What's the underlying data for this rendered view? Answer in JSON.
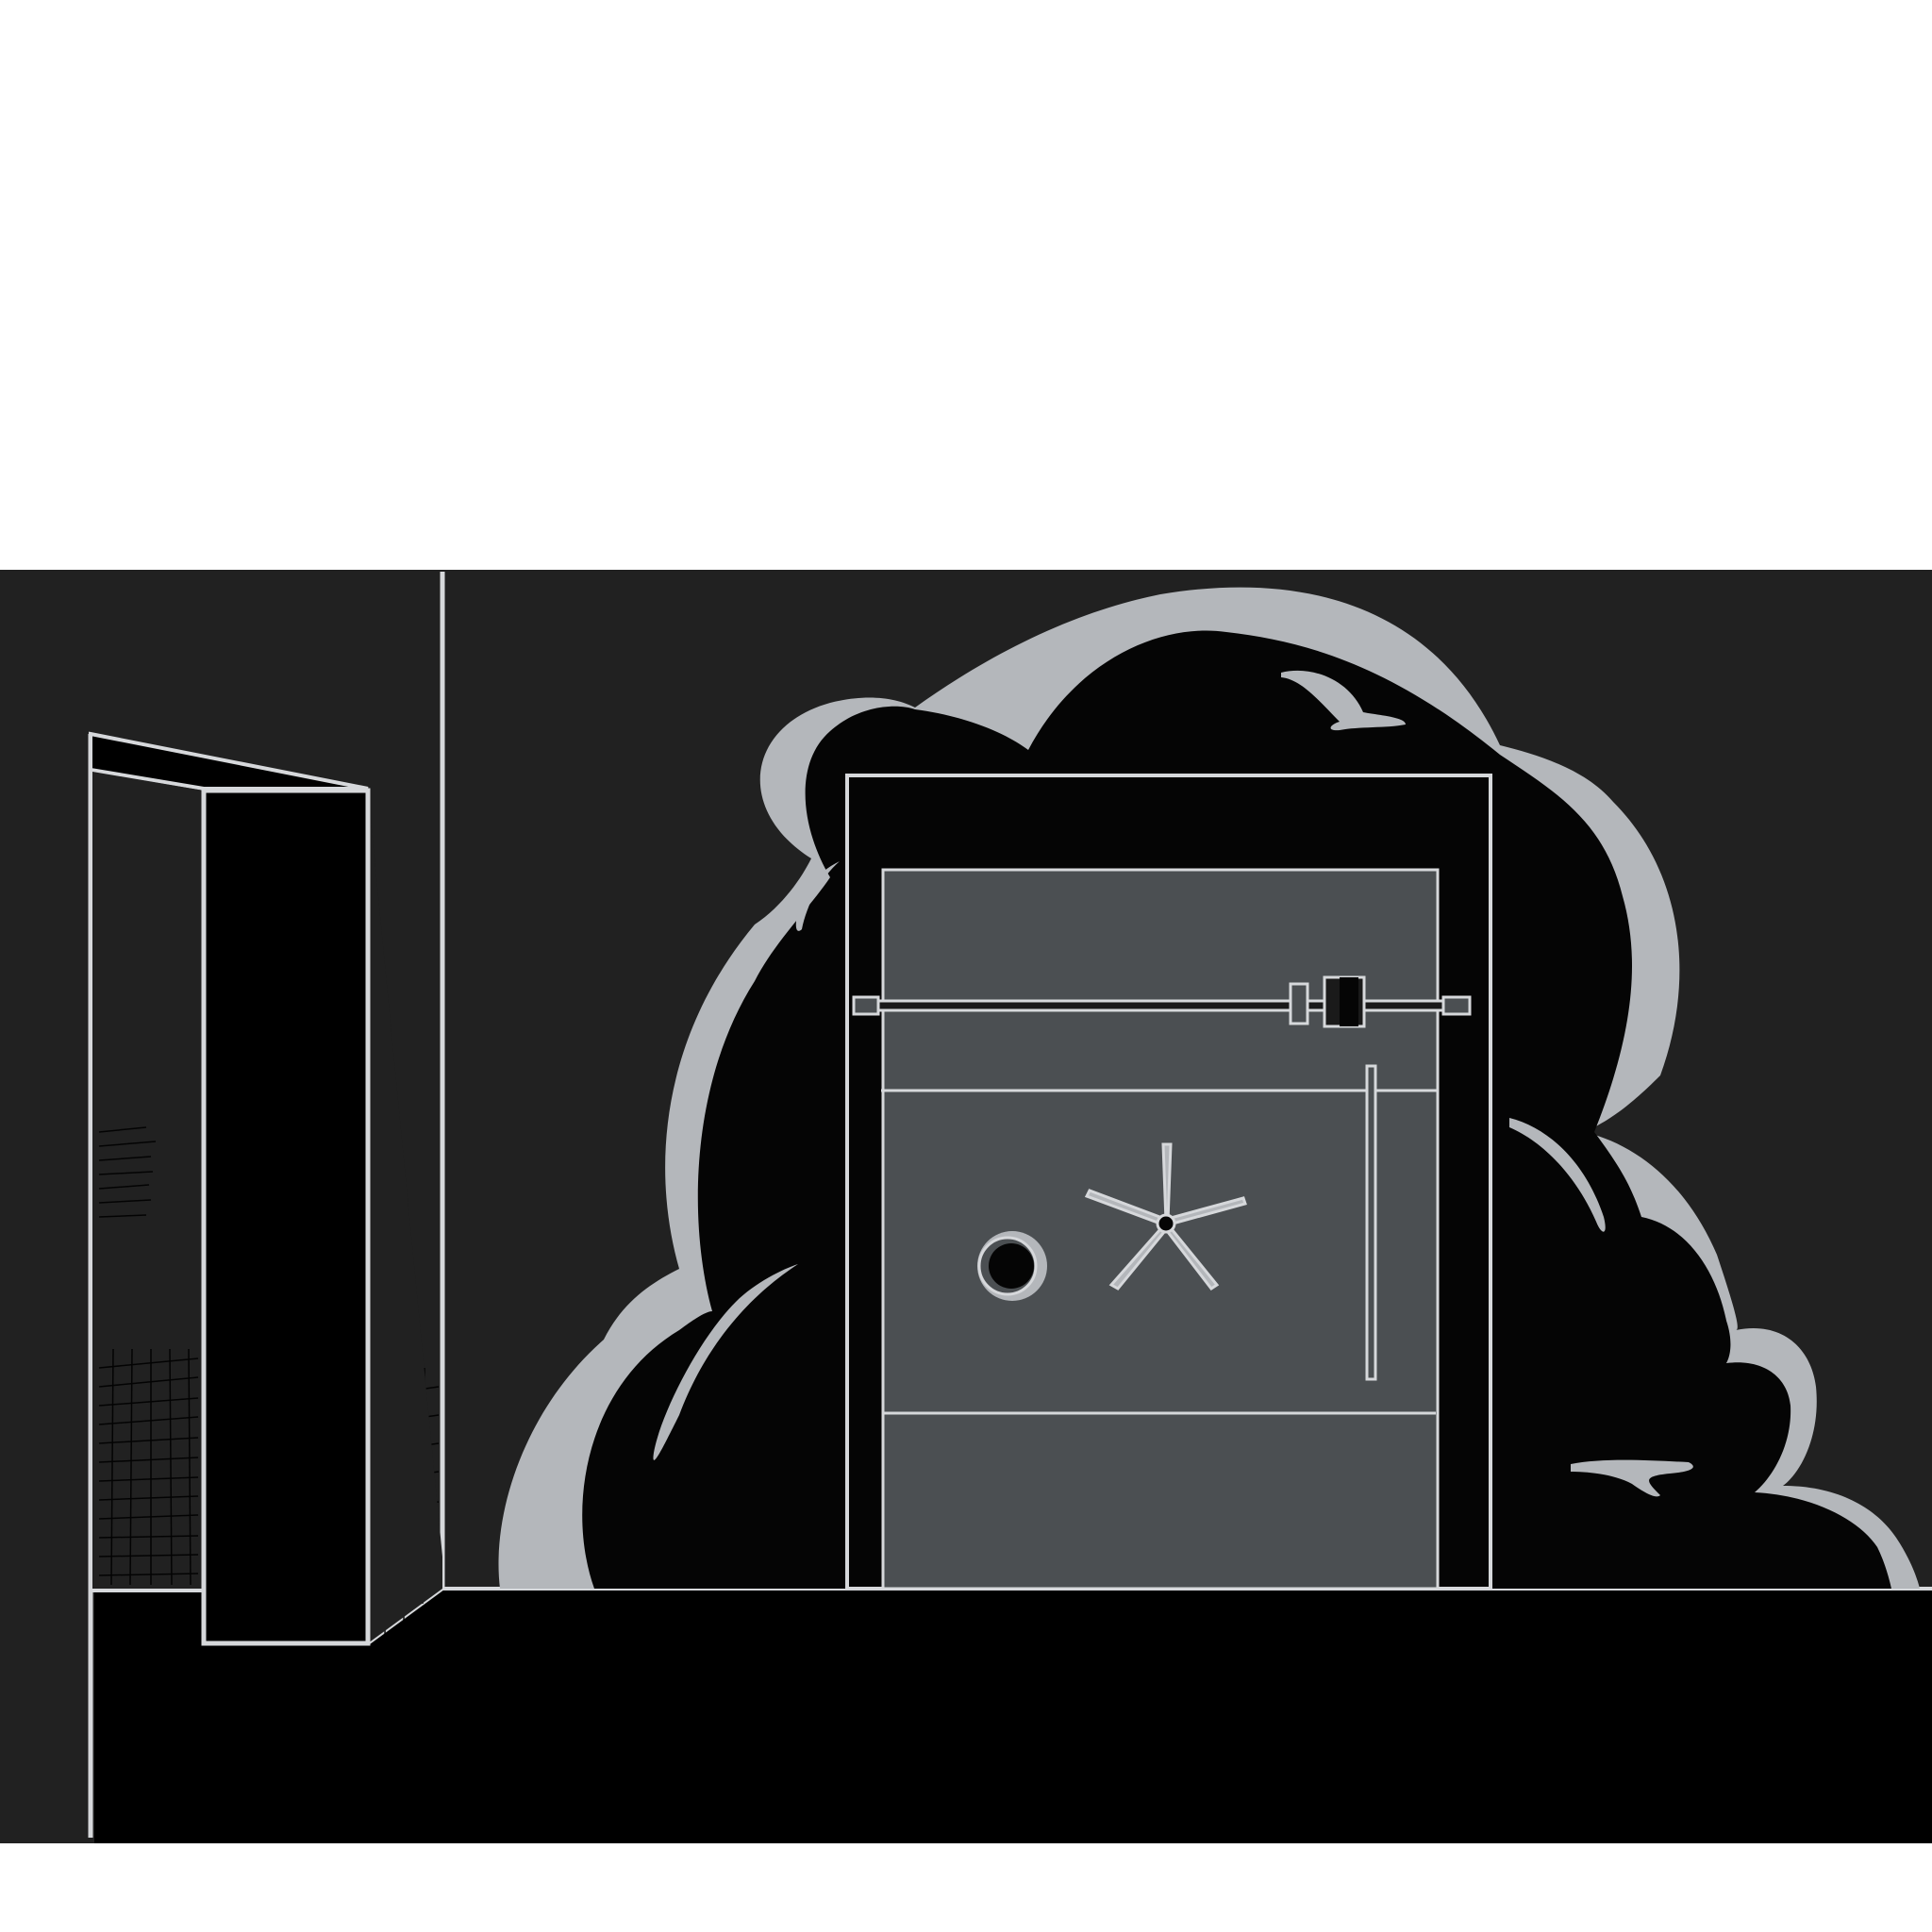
{
  "scene": {
    "description_free": true,
    "colors": {
      "background": "#ffffff",
      "wall": "#212121",
      "floor": "#000000",
      "outline": "#d6d8db",
      "cloud_shadow": "#b4b7bb",
      "cloud": "#050505",
      "vault_panel": "#4b4f52",
      "vault_frame": "#050505"
    },
    "objects": [
      {
        "name": "open-door",
        "kind": "door"
      },
      {
        "name": "vault-door",
        "kind": "vault"
      },
      {
        "name": "combination-dial",
        "kind": "dial"
      },
      {
        "name": "spoke-handle",
        "kind": "wheel"
      },
      {
        "name": "locking-bar",
        "kind": "bar"
      },
      {
        "name": "smoke-cloud",
        "kind": "cloud"
      }
    ]
  }
}
